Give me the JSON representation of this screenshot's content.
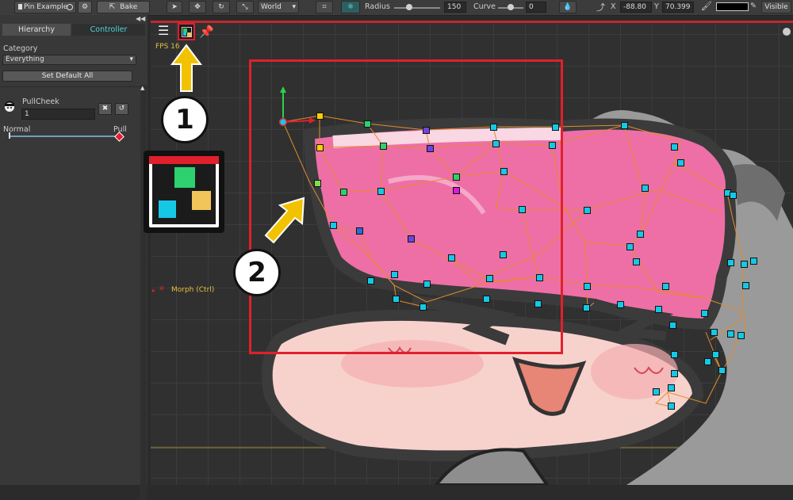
{
  "toolbar": {
    "tab_label": "Pin Example",
    "bake_label": "Bake",
    "space_select": "World",
    "radius_label": "Radius",
    "radius_value": "150",
    "curve_label": "Curve",
    "curve_value": "0",
    "x_label": "X",
    "x_value": "-88.80",
    "y_label": "Y",
    "y_value": "70.399",
    "visible_label": "Visible"
  },
  "left_panel": {
    "tabs": [
      {
        "label": "Hierarchy",
        "active": false
      },
      {
        "label": "Controller",
        "active": true
      }
    ],
    "category_label": "Category",
    "category_value": "Everything",
    "set_default_label": "Set Default All",
    "controller": {
      "name": "PullCheek",
      "value": "1",
      "min_label": "Normal",
      "max_label": "Pull",
      "level": 1.0
    }
  },
  "viewport": {
    "fps_label": "FPS 16",
    "morph_label": "Morph (Ctrl)",
    "callouts": [
      "1",
      "2"
    ]
  },
  "colors": {
    "accent_red": "#e0202c",
    "arrow_yellow": "#f2c200",
    "mesh_pink": "#ee6fa6",
    "vertex_cyan": "#15c8e6",
    "controller_tab": "#4fd6d6"
  }
}
